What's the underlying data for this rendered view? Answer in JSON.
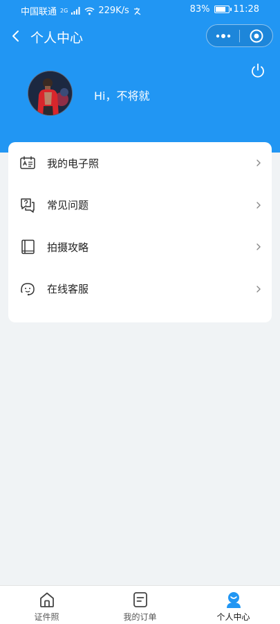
{
  "status_bar": {
    "carrier": "中国联通",
    "network_badge": "2G",
    "speed": "229K/s",
    "battery": "83%",
    "battery_level": 0.83,
    "time": "11:28"
  },
  "navbar": {
    "title": "个人中心"
  },
  "profile": {
    "greeting": "Hi，不将就"
  },
  "menu": {
    "items": [
      {
        "label": "我的电子照",
        "icon": "id-card-icon"
      },
      {
        "label": "常见问题",
        "icon": "question-chat-icon"
      },
      {
        "label": "拍摄攻略",
        "icon": "book-icon"
      },
      {
        "label": "在线客服",
        "icon": "customer-service-icon"
      }
    ]
  },
  "tabbar": {
    "tabs": [
      {
        "label": "证件照",
        "icon": "home-icon",
        "active": false
      },
      {
        "label": "我的订单",
        "icon": "order-icon",
        "active": false
      },
      {
        "label": "个人中心",
        "icon": "profile-icon",
        "active": true
      }
    ]
  },
  "colors": {
    "primary": "#2196f3",
    "background": "#f0f3f5",
    "card": "#ffffff"
  }
}
